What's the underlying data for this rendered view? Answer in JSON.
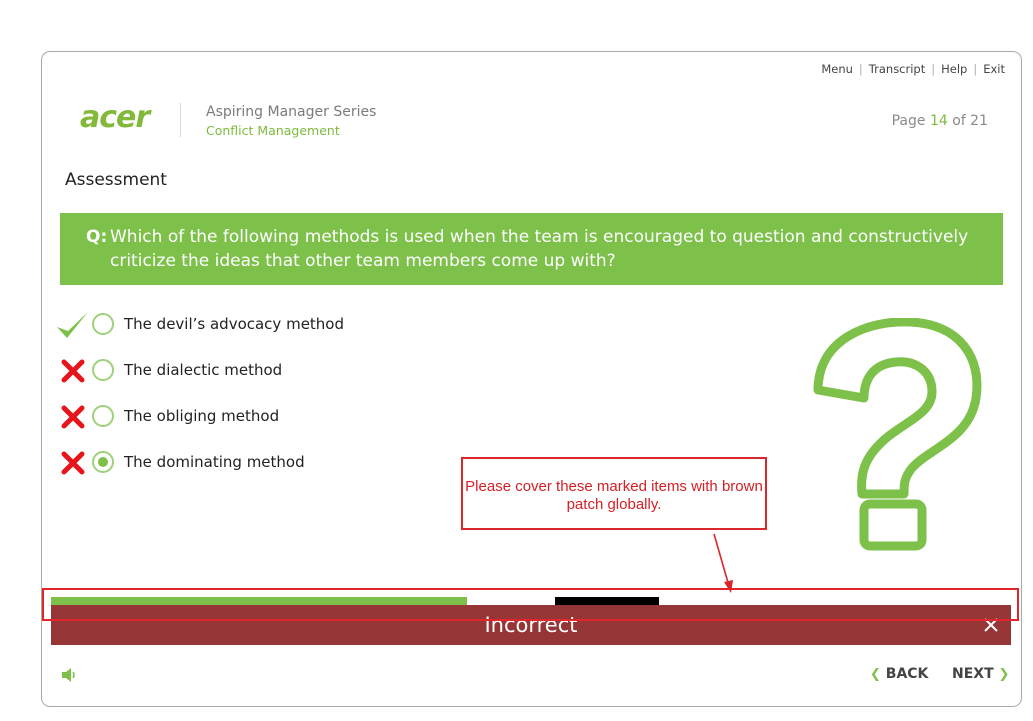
{
  "nav": {
    "menu": "Menu",
    "transcript": "Transcript",
    "help": "Help",
    "exit": "Exit"
  },
  "header": {
    "logo": "acer",
    "series": "Aspiring Manager Series",
    "course": "Conflict Management",
    "page_prefix": "Page",
    "page_current": "14",
    "page_of": "of",
    "page_total": "21"
  },
  "section_title": "Assessment",
  "question": {
    "label": "Q:",
    "text": "Which of the following methods is used when the team is encouraged to question and constructively criticize the ideas that other team members come up with?"
  },
  "options": [
    {
      "label": "The devil’s advocacy method",
      "status": "correct",
      "selected": false
    },
    {
      "label": "The dialectic method",
      "status": "incorrect",
      "selected": false
    },
    {
      "label": "The obliging method",
      "status": "incorrect",
      "selected": false
    },
    {
      "label": "The dominating method",
      "status": "incorrect",
      "selected": true
    }
  ],
  "annotation": {
    "text": "Please cover these marked items with brown patch globally."
  },
  "feedback": {
    "text": "Incorrect",
    "close_icon": "close-icon"
  },
  "footer": {
    "back": "BACK",
    "next": "NEXT"
  },
  "colors": {
    "accent_green": "#7dc14a",
    "banner_red": "#953536",
    "annotation_red": "#e0262b"
  }
}
